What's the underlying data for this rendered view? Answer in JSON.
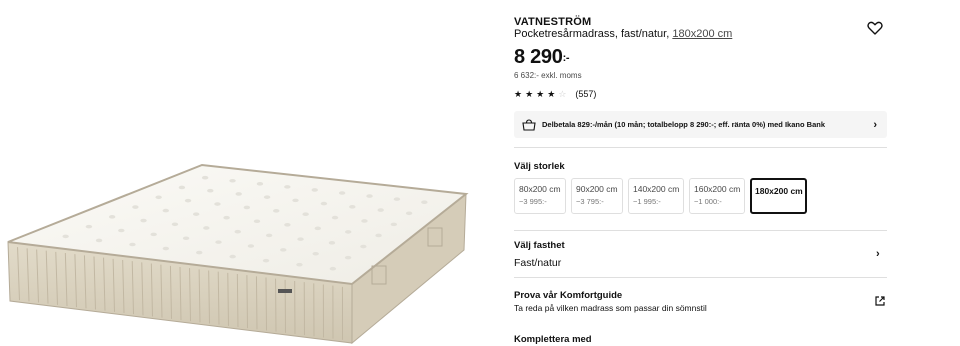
{
  "product": {
    "name": "VATNESTRÖM",
    "description": "Pocketresårmadrass, fast/natur, ",
    "size_link": "180x200 cm",
    "price": "8 290",
    "price_suffix": ":-",
    "price_ex_vat": "6 632:- exkl. moms"
  },
  "rating": {
    "stars_filled": 4,
    "stars_total": 5,
    "count": "(557)"
  },
  "finance": {
    "text": "Delbetala 829:-/mån (10 mån; totalbelopp 8 290:-; eff. ränta 0%) med Ikano Bank",
    "icon": "shopping-bag-icon"
  },
  "sizes": {
    "heading": "Välj storlek",
    "options": [
      {
        "label": "80x200 cm",
        "price": "−3 995:-"
      },
      {
        "label": "90x200 cm",
        "price": "−3 795:-"
      },
      {
        "label": "140x200 cm",
        "price": "−1 995:-"
      },
      {
        "label": "160x200 cm",
        "price": "−1 000:-"
      },
      {
        "label": "180x200 cm",
        "price": ""
      }
    ],
    "selected_index": 4
  },
  "firmness": {
    "heading": "Välj fasthet",
    "value": "Fast/natur"
  },
  "guide": {
    "title": "Prova vår Komfortguide",
    "description": "Ta reda på vilken madrass som passar din sömnstil"
  },
  "complement": {
    "heading": "Komplettera med"
  },
  "colors": {
    "mattress_top": "#f4f3ee",
    "mattress_side": "#d9d1bf",
    "border_trim": "#b5ab98"
  }
}
